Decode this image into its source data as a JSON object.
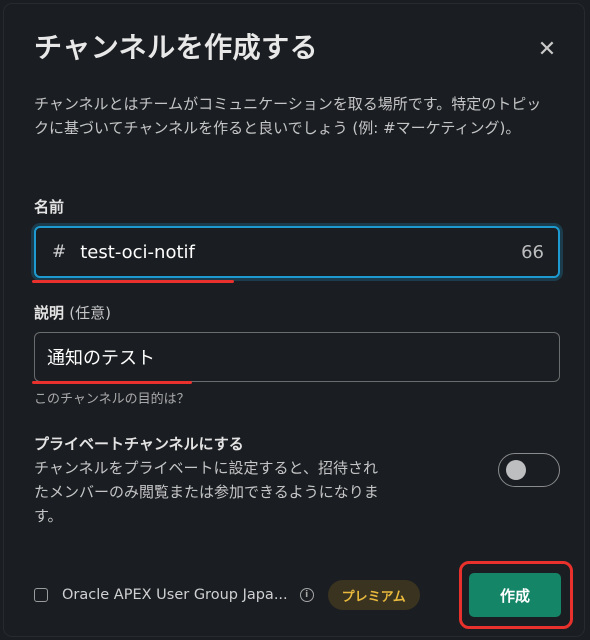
{
  "modal": {
    "title": "チャンネルを作成する",
    "description": "チャンネルとはチームがコミュニケーションを取る場所です。特定のトピックに基づいてチャンネルを作ると良いでしょう (例: #マーケティング)。"
  },
  "name_field": {
    "label": "名前",
    "prefix": "#",
    "value": "test-oci-notif",
    "remaining_chars": "66"
  },
  "desc_field": {
    "label": "説明",
    "optional": "(任意)",
    "value": "通知のテスト",
    "hint": "このチャンネルの目的は？"
  },
  "private": {
    "title": "プライベートチャンネルにする",
    "description": "チャンネルをプライベートに設定すると、招待されたメンバーのみ閲覧または参加できるようになります。",
    "enabled": false
  },
  "footer": {
    "workspace_label": "Oracle APEX User Group Japa...",
    "info_glyph": "i",
    "premium_badge": "プレミアム",
    "create_button": "作成",
    "share_checked": false
  },
  "icons": {
    "close": "close-icon",
    "info": "info-icon"
  },
  "colors": {
    "accent": "#1d9bd1",
    "create": "#148567",
    "highlight": "#e8312c",
    "premium": "#e8b93c"
  }
}
